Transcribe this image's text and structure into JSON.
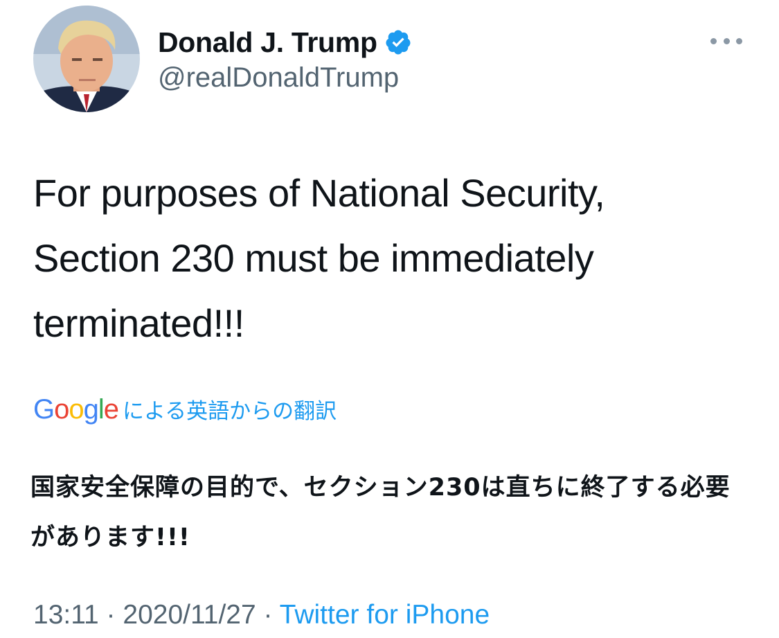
{
  "author": {
    "display_name": "Donald J. Trump",
    "handle": "@realDonaldTrump",
    "verified": true
  },
  "tweet": {
    "text": "For purposes of National Security, Section 230 must be immediately terminated!!!"
  },
  "translation": {
    "provider_logo_text": "Google",
    "label": "による英語からの翻訳",
    "text": "国家安全保障の目的で、セクション230は直ちに終了する必要があります!!!"
  },
  "meta": {
    "time": "13:11",
    "separator": "·",
    "date": "2020/11/27",
    "source": "Twitter for iPhone"
  },
  "icons": {
    "verified": "verified-badge-icon",
    "more": "more-options-icon"
  },
  "colors": {
    "text": "#0f1419",
    "secondary": "#536471",
    "link": "#1d9bf0",
    "verified": "#1d9bf0"
  }
}
